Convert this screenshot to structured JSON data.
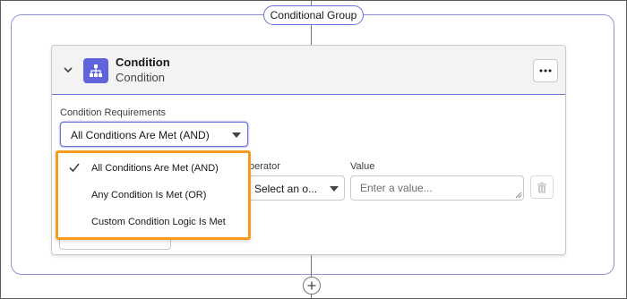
{
  "group": {
    "label": "Conditional Group"
  },
  "card": {
    "title": "Condition",
    "subtitle": "Condition",
    "more_icon": "more-horizontal-icon",
    "node_icon": "hierarchy-icon"
  },
  "requirements": {
    "label": "Condition Requirements",
    "selected": "All Conditions Are Met (AND)"
  },
  "operator": {
    "label": "Operator",
    "visible_label": "perator",
    "value": "Select an o..."
  },
  "value_field": {
    "label": "Value",
    "placeholder": "Enter a value..."
  },
  "dropdown": {
    "highlight_color": "#f39c1f",
    "options": [
      {
        "label": "All Conditions Are Met (AND)",
        "checked": true
      },
      {
        "label": "Any Condition Is Met (OR)",
        "checked": false
      },
      {
        "label": "Custom Condition Logic Is Met",
        "checked": false
      }
    ]
  },
  "colors": {
    "accent": "#6063db",
    "border_focus": "#6b70d6"
  }
}
